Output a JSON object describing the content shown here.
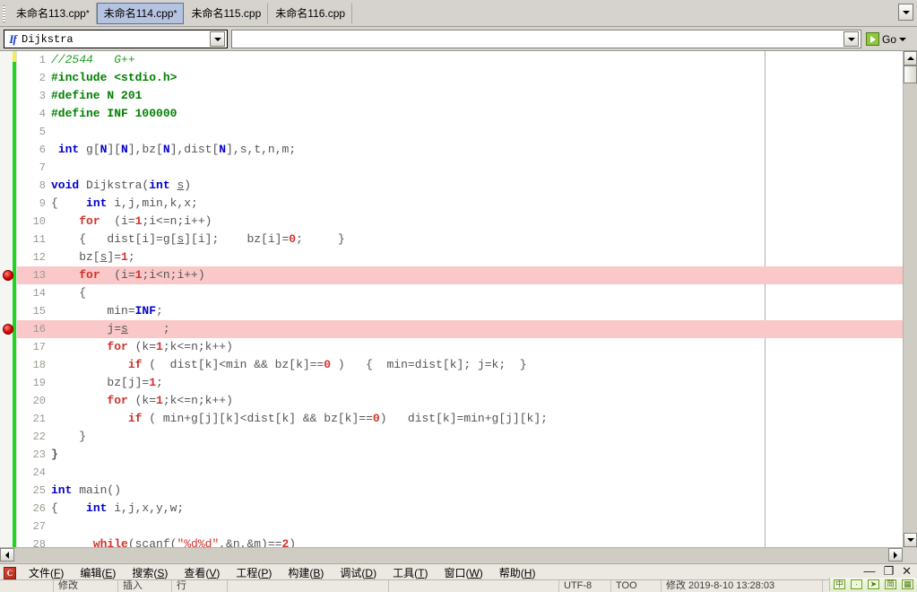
{
  "tabbar": {
    "tabs": [
      {
        "label": "未命名113.cpp",
        "modified": "*",
        "active": false
      },
      {
        "label": "未命名114.cpp",
        "modified": "*",
        "active": true
      },
      {
        "label": "未命名115.cpp",
        "modified": "",
        "active": false
      },
      {
        "label": "未命名116.cpp",
        "modified": "",
        "active": false
      }
    ],
    "dropdown_icon": "chevron-down-icon"
  },
  "toolbar": {
    "class_combo": {
      "value": "Dijkstra",
      "icon": "function-icon",
      "button_icon": "chevron-down-icon"
    },
    "address": {
      "value": "",
      "placeholder": "",
      "button_icon": "chevron-down-icon"
    },
    "go": {
      "label": "Go",
      "icon": "go-arrow-icon",
      "caret": "chevron-down-icon"
    }
  },
  "editor": {
    "margin_column_x": 853,
    "lines": [
      {
        "n": "1",
        "breakpoint": false,
        "highlight": false,
        "tokens": [
          {
            "t": "//2544   G++",
            "c": "cmt"
          }
        ]
      },
      {
        "n": "2",
        "breakpoint": false,
        "highlight": false,
        "tokens": [
          {
            "t": "#include <stdio.h>",
            "c": "pre"
          }
        ]
      },
      {
        "n": "3",
        "breakpoint": false,
        "highlight": false,
        "tokens": [
          {
            "t": "#define N 201",
            "c": "pre"
          }
        ]
      },
      {
        "n": "4",
        "breakpoint": false,
        "highlight": false,
        "tokens": [
          {
            "t": "#define INF 100000",
            "c": "pre"
          }
        ]
      },
      {
        "n": "5",
        "breakpoint": false,
        "highlight": false,
        "tokens": []
      },
      {
        "n": "6",
        "breakpoint": false,
        "highlight": false,
        "tokens": [
          {
            "t": " ",
            "c": ""
          },
          {
            "t": "int",
            "c": "kw"
          },
          {
            "t": " g[",
            "c": ""
          },
          {
            "t": "N",
            "c": "pre2"
          },
          {
            "t": "][",
            "c": ""
          },
          {
            "t": "N",
            "c": "pre2"
          },
          {
            "t": "],bz[",
            "c": ""
          },
          {
            "t": "N",
            "c": "pre2"
          },
          {
            "t": "],dist[",
            "c": ""
          },
          {
            "t": "N",
            "c": "pre2"
          },
          {
            "t": "],s,t,n,m;",
            "c": ""
          }
        ]
      },
      {
        "n": "7",
        "breakpoint": false,
        "highlight": false,
        "tokens": []
      },
      {
        "n": "8",
        "breakpoint": false,
        "highlight": false,
        "tokens": [
          {
            "t": "void",
            "c": "kw"
          },
          {
            "t": " Dijkstra(",
            "c": ""
          },
          {
            "t": "int",
            "c": "kw"
          },
          {
            "t": " ",
            "c": ""
          },
          {
            "t": "s",
            "c": "idu"
          },
          {
            "t": ")",
            "c": ""
          }
        ]
      },
      {
        "n": "9",
        "breakpoint": false,
        "highlight": false,
        "tokens": [
          {
            "t": "{    ",
            "c": ""
          },
          {
            "t": "int",
            "c": "kw"
          },
          {
            "t": " i,j,min,k,x;",
            "c": ""
          }
        ]
      },
      {
        "n": "10",
        "breakpoint": false,
        "highlight": false,
        "tokens": [
          {
            "t": "    ",
            "c": ""
          },
          {
            "t": "for",
            "c": "flow"
          },
          {
            "t": "  (i=",
            "c": ""
          },
          {
            "t": "1",
            "c": "num"
          },
          {
            "t": ";i<=n;i++)",
            "c": ""
          }
        ]
      },
      {
        "n": "11",
        "breakpoint": false,
        "highlight": false,
        "tokens": [
          {
            "t": "    {   dist[i]=g[",
            "c": ""
          },
          {
            "t": "s",
            "c": "idu"
          },
          {
            "t": "][i];    bz[i]=",
            "c": ""
          },
          {
            "t": "0",
            "c": "num"
          },
          {
            "t": ";     }",
            "c": ""
          }
        ]
      },
      {
        "n": "12",
        "breakpoint": false,
        "highlight": false,
        "tokens": [
          {
            "t": "    bz[",
            "c": ""
          },
          {
            "t": "s",
            "c": "idu"
          },
          {
            "t": "]=",
            "c": ""
          },
          {
            "t": "1",
            "c": "num"
          },
          {
            "t": ";",
            "c": ""
          }
        ]
      },
      {
        "n": "13",
        "breakpoint": true,
        "highlight": true,
        "tokens": [
          {
            "t": "    ",
            "c": ""
          },
          {
            "t": "for",
            "c": "flow"
          },
          {
            "t": "  (i=",
            "c": ""
          },
          {
            "t": "1",
            "c": "num"
          },
          {
            "t": ";i<n;i++)",
            "c": ""
          }
        ]
      },
      {
        "n": "14",
        "breakpoint": false,
        "highlight": false,
        "tokens": [
          {
            "t": "    {",
            "c": ""
          }
        ]
      },
      {
        "n": "15",
        "breakpoint": false,
        "highlight": false,
        "tokens": [
          {
            "t": "        min=",
            "c": ""
          },
          {
            "t": "INF",
            "c": "pre2"
          },
          {
            "t": ";",
            "c": ""
          }
        ]
      },
      {
        "n": "16",
        "breakpoint": true,
        "highlight": true,
        "tokens": [
          {
            "t": "        j=",
            "c": ""
          },
          {
            "t": "s",
            "c": "idu"
          },
          {
            "t": "     ;",
            "c": ""
          }
        ]
      },
      {
        "n": "17",
        "breakpoint": false,
        "highlight": false,
        "tokens": [
          {
            "t": "        ",
            "c": ""
          },
          {
            "t": "for",
            "c": "flow"
          },
          {
            "t": " (k=",
            "c": ""
          },
          {
            "t": "1",
            "c": "num"
          },
          {
            "t": ";k<=n;k++)",
            "c": ""
          }
        ]
      },
      {
        "n": "18",
        "breakpoint": false,
        "highlight": false,
        "tokens": [
          {
            "t": "           ",
            "c": ""
          },
          {
            "t": "if",
            "c": "flow"
          },
          {
            "t": " (  dist[k]<min && bz[k]==",
            "c": ""
          },
          {
            "t": "0",
            "c": "num"
          },
          {
            "t": " )   {  min=dist[k]; j=k;  }",
            "c": ""
          }
        ]
      },
      {
        "n": "19",
        "breakpoint": false,
        "highlight": false,
        "tokens": [
          {
            "t": "        bz[j]=",
            "c": ""
          },
          {
            "t": "1",
            "c": "num"
          },
          {
            "t": ";",
            "c": ""
          }
        ]
      },
      {
        "n": "20",
        "breakpoint": false,
        "highlight": false,
        "tokens": [
          {
            "t": "        ",
            "c": ""
          },
          {
            "t": "for",
            "c": "flow"
          },
          {
            "t": " (k=",
            "c": ""
          },
          {
            "t": "1",
            "c": "num"
          },
          {
            "t": ";k<=n;k++)",
            "c": ""
          }
        ]
      },
      {
        "n": "21",
        "breakpoint": false,
        "highlight": false,
        "tokens": [
          {
            "t": "           ",
            "c": ""
          },
          {
            "t": "if",
            "c": "flow"
          },
          {
            "t": " ( min+g[j][k]<dist[k] && bz[k]==",
            "c": ""
          },
          {
            "t": "0",
            "c": "num"
          },
          {
            "t": ")   dist[k]=min+g[j][k];",
            "c": ""
          }
        ]
      },
      {
        "n": "22",
        "breakpoint": false,
        "highlight": false,
        "tokens": [
          {
            "t": "    }",
            "c": ""
          }
        ]
      },
      {
        "n": "23",
        "breakpoint": false,
        "highlight": false,
        "tokens": [
          {
            "t": "}",
            "c": "bold"
          }
        ]
      },
      {
        "n": "24",
        "breakpoint": false,
        "highlight": false,
        "tokens": []
      },
      {
        "n": "25",
        "breakpoint": false,
        "highlight": false,
        "tokens": [
          {
            "t": "int",
            "c": "kw"
          },
          {
            "t": " main()",
            "c": ""
          }
        ]
      },
      {
        "n": "26",
        "breakpoint": false,
        "highlight": false,
        "tokens": [
          {
            "t": "{    ",
            "c": ""
          },
          {
            "t": "int",
            "c": "kw"
          },
          {
            "t": " i,j,x,y,w;",
            "c": ""
          }
        ]
      },
      {
        "n": "27",
        "breakpoint": false,
        "highlight": false,
        "tokens": []
      },
      {
        "n": "28",
        "breakpoint": false,
        "highlight": false,
        "tokens": [
          {
            "t": "      ",
            "c": ""
          },
          {
            "t": "while",
            "c": "flow"
          },
          {
            "t": "(scanf(",
            "c": ""
          },
          {
            "t": "\"%d%d\"",
            "c": "str"
          },
          {
            "t": ",&n,&m)==",
            "c": ""
          },
          {
            "t": "2",
            "c": "num"
          },
          {
            "t": ")",
            "c": ""
          }
        ]
      }
    ]
  },
  "scrollbars": {
    "vertical": {
      "up_icon": "caret-up-icon",
      "down_icon": "caret-down-icon"
    },
    "horizontal": {
      "left_icon": "caret-left-icon",
      "right_icon": "caret-right-icon"
    }
  },
  "menubar": {
    "logo": "devcpp-logo-icon",
    "items": [
      {
        "label": "文件",
        "accel": "F"
      },
      {
        "label": "编辑",
        "accel": "E"
      },
      {
        "label": "搜索",
        "accel": "S"
      },
      {
        "label": "查看",
        "accel": "V"
      },
      {
        "label": "工程",
        "accel": "P"
      },
      {
        "label": "构建",
        "accel": "B"
      },
      {
        "label": "调试",
        "accel": "D"
      },
      {
        "label": "工具",
        "accel": "T"
      },
      {
        "label": "窗口",
        "accel": "W"
      },
      {
        "label": "帮助",
        "accel": "H"
      }
    ],
    "window_controls": [
      {
        "name": "minimize-button",
        "glyph": "—"
      },
      {
        "name": "restore-button",
        "glyph": "❐"
      },
      {
        "name": "close-button",
        "glyph": "✕"
      }
    ]
  },
  "statusbar": {
    "cells": [
      "",
      "修改",
      "插入",
      "行",
      "",
      "",
      "UTF-8",
      "TOO",
      "修改  2019-8-10  13:28:03"
    ]
  },
  "imebar": {
    "items": [
      "中",
      "·",
      "➤",
      "简",
      "▦"
    ]
  },
  "colors": {
    "window_bg": "#d6d3ce",
    "editor_bg": "#ffffff",
    "active_tab_bg": "#b5c3e0",
    "active_tab_border": "#5a6ea3",
    "highlight_line": "#fac8c8",
    "modified_bar": "#22d422",
    "unsaved_bar": "#f2ee5a",
    "keyword": "#0000cd",
    "preprocessor": "#008000",
    "comment": "#1f9d1f",
    "flow_keyword": "#d2322d",
    "number": "#d2322d",
    "linenumber": "#9a9a92",
    "breakpoint": "#e00000"
  }
}
